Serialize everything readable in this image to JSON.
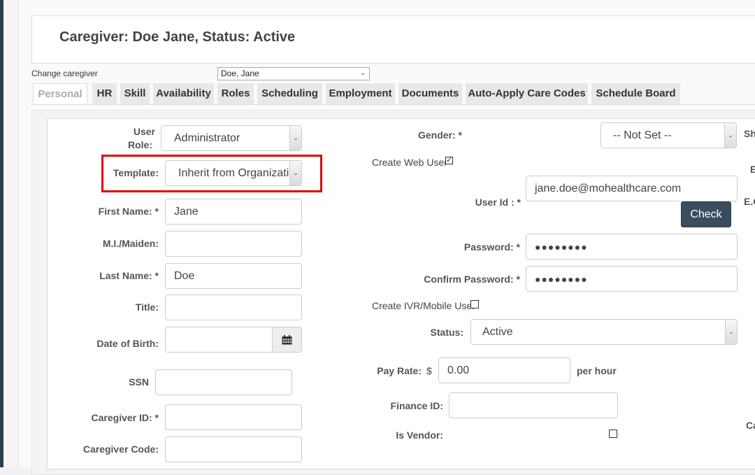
{
  "page": {
    "title": "Caregiver: Doe Jane, Status: Active",
    "change_caregiver_label": "Change caregiver",
    "caregiver_select_value": "Doe, Jane"
  },
  "tabs": [
    {
      "label": "Personal",
      "active": true
    },
    {
      "label": "HR"
    },
    {
      "label": "Skill"
    },
    {
      "label": "Availability"
    },
    {
      "label": "Roles"
    },
    {
      "label": "Scheduling"
    },
    {
      "label": "Employment"
    },
    {
      "label": "Documents"
    },
    {
      "label": "Auto-Apply Care Codes"
    },
    {
      "label": "Schedule Board"
    }
  ],
  "left_form": {
    "user_role_label_1": "User",
    "user_role_label_2": "Role:",
    "user_role_value": "Administrator",
    "template_label": "Template:",
    "template_value": "Inherit from Organizatio",
    "first_name_label": "First Name: *",
    "first_name_value": "Jane",
    "mi_label": "M.I./Maiden:",
    "mi_value": "",
    "last_name_label": "Last Name: *",
    "last_name_value": "Doe",
    "title_label": "Title:",
    "title_value": "",
    "dob_label": "Date of Birth:",
    "dob_value": "",
    "ssn_label": "SSN",
    "ssn_value": "",
    "caregiver_id_label": "Caregiver ID: *",
    "caregiver_id_value": "",
    "caregiver_code_label": "Caregiver Code:",
    "caregiver_code_value": ""
  },
  "middle_form": {
    "gender_label": "Gender: *",
    "gender_value": "-- Not Set --",
    "create_web_user_label": "Create Web User",
    "create_web_user_checked": true,
    "user_id_label": "User Id : *",
    "user_id_value": "jane.doe@mohealthcare.com",
    "check_button": "Check",
    "password_label": "Password: *",
    "password_value": "●●●●●●●●",
    "confirm_password_label": "Confirm Password: *",
    "confirm_password_value": "●●●●●●●●",
    "create_ivr_label": "Create IVR/Mobile User",
    "create_ivr_checked": false,
    "status_label": "Status:",
    "status_value": "Active",
    "pay_rate_label": "Pay Rate:",
    "pay_rate_currency": "$",
    "pay_rate_value": "0.00",
    "pay_rate_unit": "per hour",
    "finance_id_label": "Finance ID:",
    "finance_id_value": "",
    "is_vendor_label": "Is Vendor:",
    "is_vendor_checked": false
  },
  "right_clipped": {
    "label_1": "Sh",
    "label_2": "E",
    "label_3": "E.C",
    "label_4": "Ca"
  },
  "colors": {
    "highlight": "#e00000",
    "check_button": "#3a4d5f",
    "sidebar": "#2c3e50"
  },
  "icons": {
    "calendar": "calendar-icon",
    "dropdown": "chevron-down-icon"
  }
}
